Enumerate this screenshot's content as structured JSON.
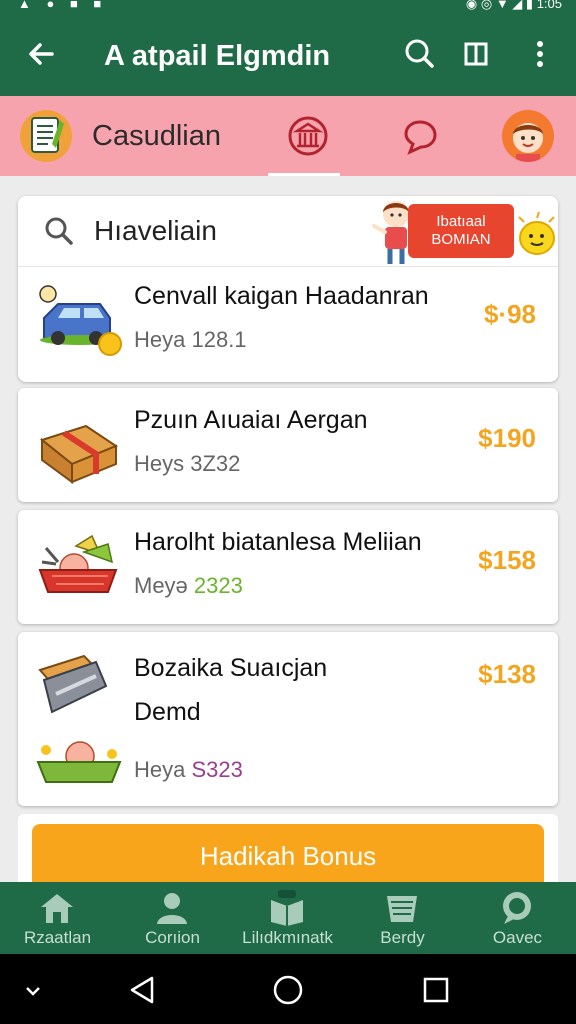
{
  "status_bar": {
    "time": "1:05"
  },
  "app_bar": {
    "title": "A atpail Elgmdin"
  },
  "tabs": {
    "primary_label": "Casudlian"
  },
  "search": {
    "query": "Hıaveliain"
  },
  "promo_banner": {
    "label_line1": "Ibatıaal",
    "label_line2": "BOMIAN"
  },
  "items": [
    {
      "title": "Cenvall kaigan Haadanran",
      "subtitle_label": "Heya",
      "subtitle_value": "128.1",
      "price": "$·98"
    },
    {
      "title": "Pzuın Aıuaiaı Aergan",
      "subtitle_label": "Heys",
      "subtitle_value": "3Z32",
      "price": "$190"
    },
    {
      "title": "Harolht biatanlesa Meliian",
      "subtitle_label": "Meyə",
      "subtitle_value": "2323",
      "price": "$158"
    },
    {
      "title_line1": "Bozaika Suaıcjan",
      "title_line2": "Demd",
      "subtitle_label": "Heya",
      "subtitle_value": "S323",
      "price": "$138"
    }
  ],
  "cta": {
    "label": "Hadikah Bonus"
  },
  "bottom_nav": [
    {
      "label": "Rzaatlan",
      "icon": "home-icon"
    },
    {
      "label": "Corıion",
      "icon": "person-icon"
    },
    {
      "label": "Lilıdkmınatk",
      "icon": "book-icon"
    },
    {
      "label": "Berdy",
      "icon": "basket-icon"
    },
    {
      "label": "Oavec",
      "icon": "chat-icon"
    }
  ],
  "colors": {
    "primary": "#1f6b47",
    "tab_bar": "#f7a3ad",
    "price": "#f3a51f",
    "cta": "#f9a51b",
    "accent_green_value": "#6ab42d",
    "accent_purple_value": "#9a3e8f"
  }
}
